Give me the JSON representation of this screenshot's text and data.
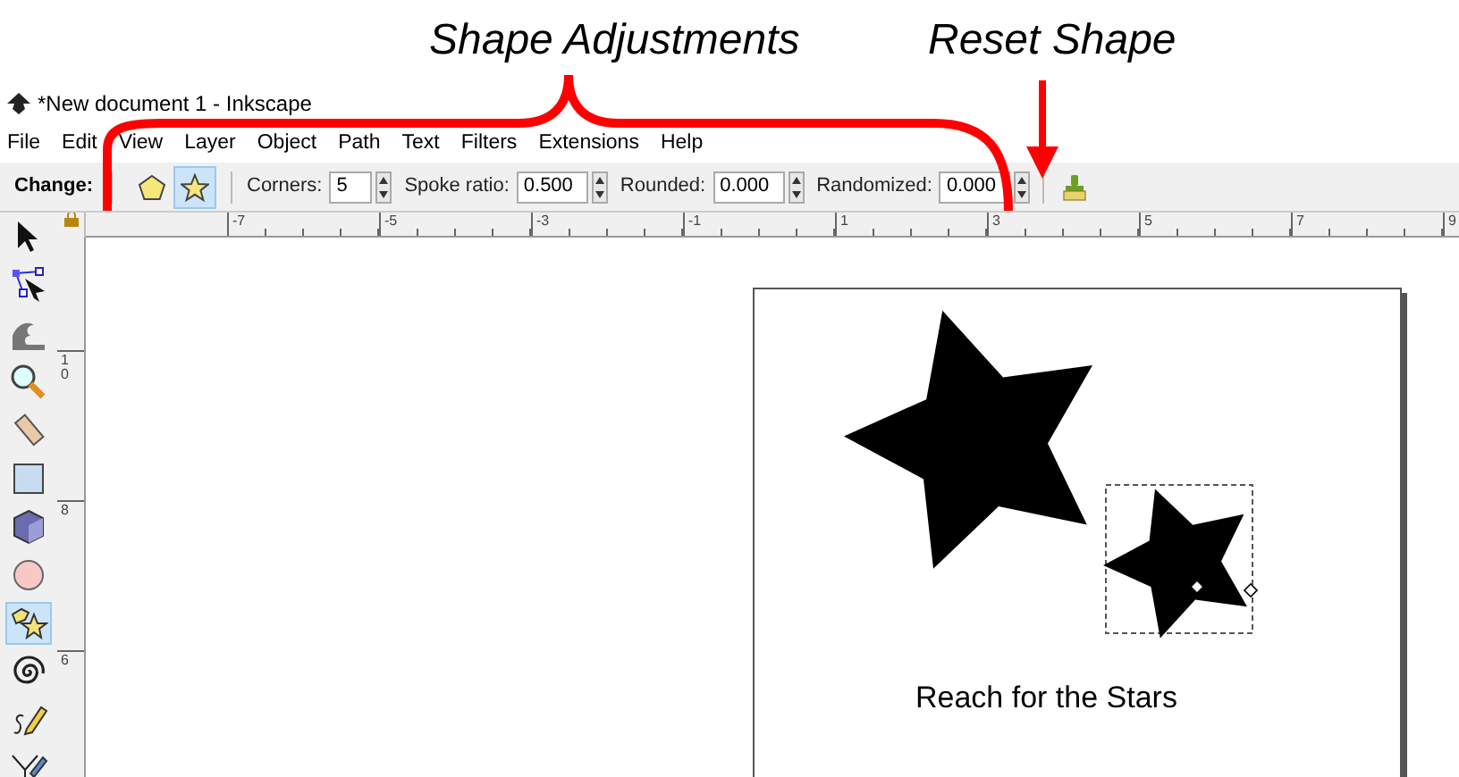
{
  "annotations": [
    {
      "text": "Shape Adjustments"
    },
    {
      "text": "Reset Shape"
    }
  ],
  "window": {
    "title": "*New document 1 - Inkscape"
  },
  "menu": [
    "File",
    "Edit",
    "View",
    "Layer",
    "Object",
    "Path",
    "Text",
    "Filters",
    "Extensions",
    "Help"
  ],
  "toolbar": {
    "label": "Change:",
    "shape_buttons": [
      {
        "kind": "polygon",
        "selected": false
      },
      {
        "kind": "star",
        "selected": true
      }
    ],
    "fields": [
      {
        "label": "Corners:",
        "value": "5"
      },
      {
        "label": "Spoke ratio:",
        "value": "0.500"
      },
      {
        "label": "Rounded:",
        "value": "0.000"
      },
      {
        "label": "Randomized:",
        "value": "0.000"
      }
    ]
  },
  "horizontal_ruler": [
    "-7",
    "-5",
    "-3",
    "-1",
    "1",
    "3",
    "5",
    "7",
    "9"
  ],
  "vertical_ruler": [
    "10",
    "8",
    "6"
  ],
  "tools": [
    {
      "kind": "select",
      "selected": false
    },
    {
      "kind": "node",
      "selected": false
    },
    {
      "kind": "tweak",
      "selected": false
    },
    {
      "kind": "zoom",
      "selected": false
    },
    {
      "kind": "measure",
      "selected": false
    },
    {
      "kind": "rect",
      "selected": false
    },
    {
      "kind": "box3d",
      "selected": false
    },
    {
      "kind": "ellipse",
      "selected": false
    },
    {
      "kind": "star",
      "selected": true
    },
    {
      "kind": "spiral",
      "selected": false
    },
    {
      "kind": "pencil",
      "selected": false
    },
    {
      "kind": "pen",
      "selected": false
    }
  ],
  "canvas": {
    "text": "Reach for the Stars"
  }
}
